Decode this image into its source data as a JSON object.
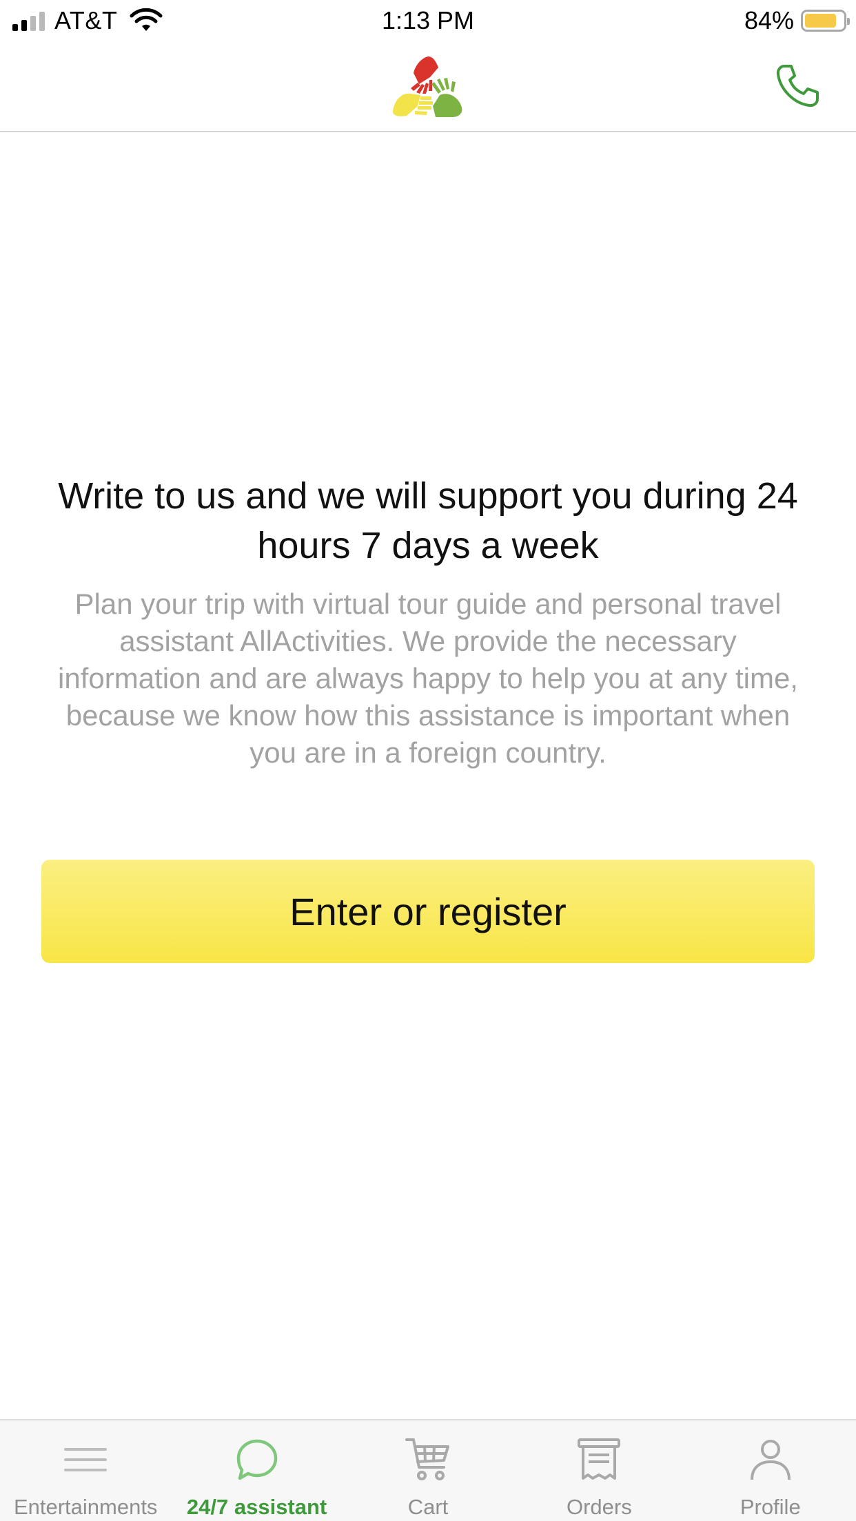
{
  "status_bar": {
    "carrier": "AT&T",
    "time": "1:13 PM",
    "battery_percent": "84%",
    "battery_level": 0.84,
    "signal_bars_on": 2,
    "signal_bars_total": 4
  },
  "header": {
    "logo_icon": "hands-triangle-logo",
    "phone_icon": "phone-icon"
  },
  "main": {
    "headline": "Write to us and we will support you during 24 hours 7 days a week",
    "description": "Plan your trip with virtual tour guide and personal travel assistant AllActivities. We provide the necessary information and are always happy to help you at any time, because we know how this assistance is important when you are in a foreign country.",
    "cta_label": "Enter or register"
  },
  "tabbar": {
    "tabs": [
      {
        "label": "Entertainments",
        "icon": "menu-lines-icon",
        "active": false
      },
      {
        "label": "24/7 assistant",
        "icon": "chat-bubble-icon",
        "active": true
      },
      {
        "label": "Cart",
        "icon": "cart-icon",
        "active": false
      },
      {
        "label": "Orders",
        "icon": "receipt-icon",
        "active": false
      },
      {
        "label": "Profile",
        "icon": "person-icon",
        "active": false
      }
    ]
  },
  "colors": {
    "accent_green": "#3f9a3c",
    "button_yellow": "#f8e546",
    "logo_red": "#d9332b",
    "logo_yellow": "#f3e34a",
    "logo_green": "#7cb342",
    "battery_yellow": "#f7c948"
  }
}
